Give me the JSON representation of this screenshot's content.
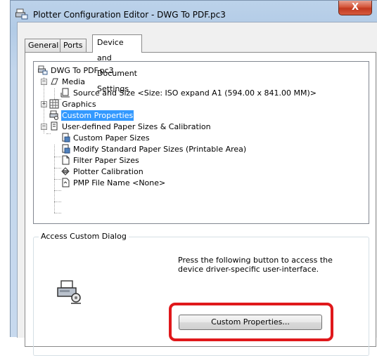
{
  "window": {
    "title": "Plotter Configuration Editor - DWG To PDF.pc3",
    "close_label": "X"
  },
  "tabs": [
    {
      "label": "General",
      "active": false
    },
    {
      "label": "Ports",
      "active": false
    },
    {
      "label": "Device and Document Settings",
      "active": true
    }
  ],
  "tree": {
    "root": "DWG To PDF.pc3",
    "media": "Media",
    "source_size": "Source and Size <Size: ISO expand A1 (594.00 x 841.00 MM)>",
    "graphics": "Graphics",
    "custom_properties": "Custom Properties",
    "user_defined": "User-defined Paper Sizes & Calibration",
    "custom_paper_sizes": "Custom Paper Sizes",
    "modify_standard": "Modify Standard Paper Sizes (Printable Area)",
    "filter_paper": "Filter Paper Sizes",
    "plotter_calibration": "Plotter Calibration",
    "pmp_file": "PMP File Name <None>"
  },
  "access_group": {
    "title": "Access Custom Dialog",
    "description_line1": "Press the following button to access the",
    "description_line2": "device driver-specific user-interface.",
    "button_label": "Custom Properties..."
  },
  "colors": {
    "selection": "#3399ff",
    "highlight_border": "#e0181b",
    "close_button": "#c2391f"
  }
}
